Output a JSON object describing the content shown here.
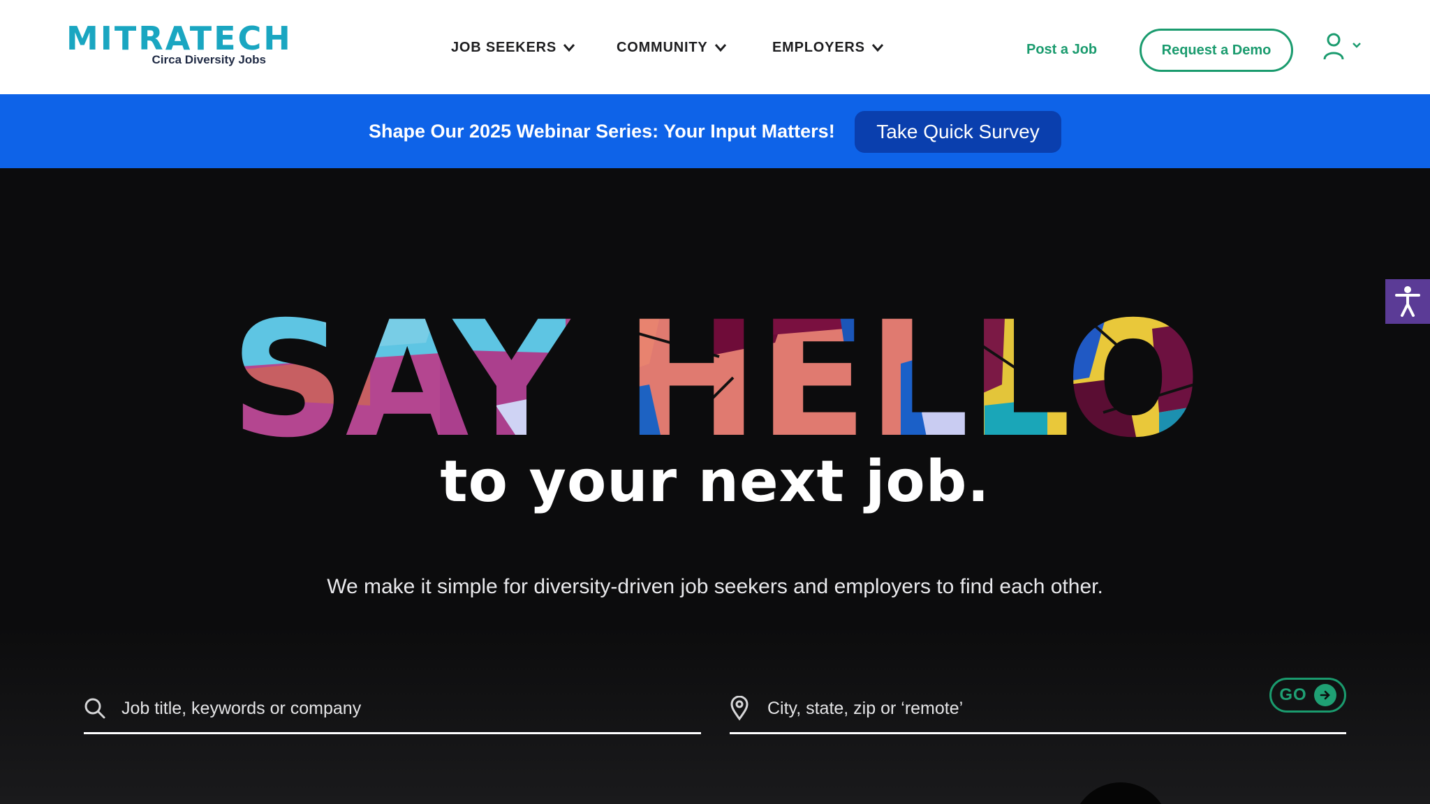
{
  "header": {
    "logo": {
      "wordmark": "MITRATECH",
      "subline": "Circa Diversity Jobs"
    },
    "nav": [
      {
        "label": "JOB SEEKERS",
        "icon": "chevron-down-icon"
      },
      {
        "label": "COMMUNITY",
        "icon": "chevron-down-icon"
      },
      {
        "label": "EMPLOYERS",
        "icon": "chevron-down-icon"
      }
    ],
    "post_job_label": "Post a Job",
    "demo_label": "Request a Demo",
    "user_icon": "user-icon"
  },
  "banner": {
    "text": "Shape Our 2025 Webinar Series: Your Input Matters!",
    "button_label": "Take Quick Survey"
  },
  "hero": {
    "headline": "SAY HELLO",
    "tagline": "to your next job.",
    "subtitle": "We make it simple for diversity-driven job seekers and employers to find each other."
  },
  "search": {
    "keyword_placeholder": "Job title, keywords or company",
    "location_placeholder": "City, state, zip or ‘remote’",
    "go_label": "GO"
  },
  "accessibility_icon": "accessibility-icon",
  "colors": {
    "brand_teal": "#1aa6c1",
    "brand_green": "#1a9b6e",
    "banner_blue": "#0e63e8",
    "survey_button": "#0a3fae",
    "hero_background": "#0c0c0d",
    "accessibility_purple": "#5b3b96"
  }
}
